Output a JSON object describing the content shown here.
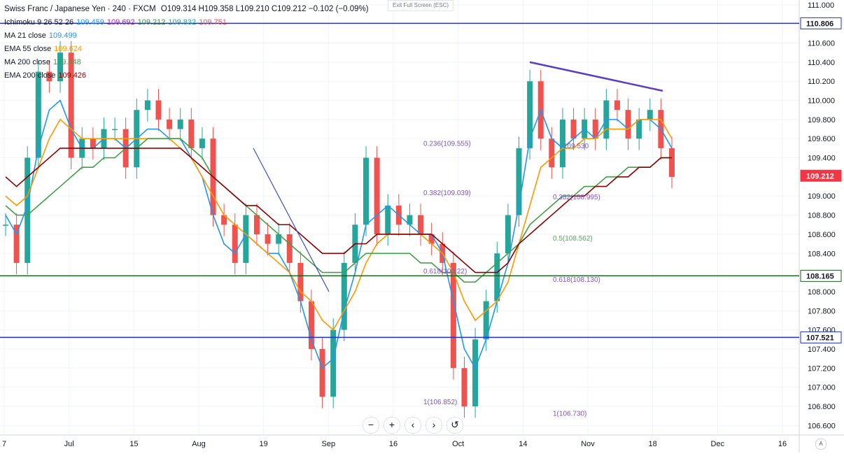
{
  "header": {
    "symbol_line": "Swiss Franc / Japanese Yen · 240 · FXCM",
    "ohlc": "O109.314  H109.358  L109.210  C109.212  −0.102 (−0.09%)",
    "exit_fullscreen": "Exit Full Screen (ESC)"
  },
  "legend": [
    {
      "label": "Ichimoku 9 26 52 26",
      "values": [
        "109.459",
        "109.692",
        "109.212",
        "109.832",
        "109.751"
      ],
      "colors": [
        "#2196f3",
        "#9c27b0",
        "#388e3c",
        "#26a69a",
        "#ef5350"
      ]
    },
    {
      "label": "MA 21 close",
      "values": [
        "109.499"
      ],
      "colors": [
        "#2196f3"
      ]
    },
    {
      "label": "EMA 55 close",
      "values": [
        "109.624"
      ],
      "colors": [
        "#ff9800"
      ]
    },
    {
      "label": "MA 200 close",
      "values": [
        "109.448"
      ],
      "colors": [
        "#43a047"
      ]
    },
    {
      "label": "EMA 200 close",
      "values": [
        "109.426"
      ],
      "colors": [
        "#8b0000"
      ]
    }
  ],
  "toolbar": {
    "zoom_out": "−",
    "zoom_in": "+",
    "prev": "‹",
    "next": "›",
    "reset": "↺"
  },
  "corner_label": "A",
  "colors": {
    "up": "#26a69a",
    "down": "#ef5350",
    "ma21": "#2196f3",
    "ema55": "#ff9800",
    "ma200": "#43a047",
    "ema200": "#8b0000",
    "hline_blue": "#1f2fd8",
    "hline_green": "#1b5e20",
    "trend": "#5c3dbf",
    "fib": "#7e57c2",
    "fib_green": "#4caf50"
  },
  "chart_data": {
    "type": "line",
    "title": "Swiss Franc / Japanese Yen · 240 · FXCM",
    "xlabel": "",
    "ylabel": "",
    "ylim": [
      106.5,
      111.05
    ],
    "y_ticks": [
      "111.000",
      "110.600",
      "110.400",
      "110.200",
      "110.000",
      "109.800",
      "109.600",
      "109.400",
      "109.000",
      "108.800",
      "108.600",
      "108.400",
      "108.000",
      "107.800",
      "107.600",
      "107.400",
      "107.200",
      "107.000",
      "106.800",
      "106.600"
    ],
    "x_ticks": [
      "7",
      "Jul",
      "15",
      "Aug",
      "19",
      "Sep",
      "16",
      "Oct",
      "14",
      "Nov",
      "18",
      "Dec",
      "16"
    ],
    "price_labels": [
      {
        "text": "110.806",
        "value": 110.806,
        "style": "blue"
      },
      {
        "text": "109.212",
        "value": 109.212,
        "style": "red"
      },
      {
        "text": "108.165",
        "value": 108.165,
        "style": "green"
      },
      {
        "text": "107.521",
        "value": 107.521,
        "style": "blue"
      }
    ],
    "horizontal_lines": [
      {
        "value": 110.806,
        "color": "blue"
      },
      {
        "value": 108.165,
        "color": "green"
      },
      {
        "value": 107.521,
        "color": "blue"
      }
    ],
    "fib_labels": [
      {
        "text": "0.236(109.555)",
        "value": 109.555
      },
      {
        "text": "0.382(109.039)",
        "value": 109.039
      },
      {
        "text": "0.618(108.22)",
        "value": 108.22
      },
      {
        "text": "1(106.852)",
        "value": 106.852
      },
      {
        "text": "0.382(108.995)",
        "value": 108.995
      },
      {
        "text": "0.5(108.562)",
        "value": 108.562
      },
      {
        "text": "0.618(108.130)",
        "value": 108.13
      },
      {
        "text": "1(106.730)",
        "value": 106.73
      },
      {
        "text": "109.530",
        "value": 109.53
      }
    ],
    "series": [
      {
        "name": "Price",
        "values": [
          108.7,
          108.3,
          109.4,
          110.3,
          110.2,
          110.5,
          109.4,
          109.6,
          109.5,
          109.7,
          109.7,
          109.3,
          109.9,
          110.0,
          109.8,
          109.7,
          109.8,
          109.5,
          109.6,
          108.8,
          108.7,
          108.3,
          108.8,
          108.6,
          108.5,
          108.6,
          108.3,
          107.9,
          107.4,
          106.9,
          107.6,
          108.3,
          108.7,
          109.4,
          108.6,
          108.9,
          108.7,
          108.8,
          108.6,
          108.5,
          108.3,
          107.2,
          106.8,
          107.5,
          107.9,
          108.4,
          108.8,
          109.5,
          110.2,
          109.6,
          109.3,
          109.8,
          109.6,
          109.8,
          109.6,
          110.0,
          109.9,
          109.6,
          109.8,
          109.9,
          109.5,
          109.2
        ]
      },
      {
        "name": "MA 21 close",
        "values": [
          108.8,
          108.6,
          108.9,
          109.5,
          109.9,
          110.0,
          109.7,
          109.5,
          109.5,
          109.6,
          109.6,
          109.5,
          109.6,
          109.7,
          109.7,
          109.6,
          109.6,
          109.4,
          109.2,
          108.8,
          108.5,
          108.4,
          108.6,
          108.5,
          108.4,
          108.4,
          108.2,
          107.9,
          107.5,
          107.2,
          107.3,
          107.8,
          108.2,
          108.7,
          108.8,
          108.9,
          108.8,
          108.7,
          108.6,
          108.6,
          108.4,
          107.9,
          107.4,
          107.2,
          107.5,
          107.9,
          108.3,
          108.9,
          109.6,
          109.9,
          109.6,
          109.5,
          109.6,
          109.7,
          109.6,
          109.8,
          109.8,
          109.7,
          109.8,
          109.8,
          109.7,
          109.5
        ]
      },
      {
        "name": "EMA 55 close",
        "values": [
          109.0,
          108.9,
          109.0,
          109.3,
          109.6,
          109.8,
          109.7,
          109.6,
          109.6,
          109.6,
          109.6,
          109.6,
          109.6,
          109.6,
          109.6,
          109.6,
          109.5,
          109.4,
          109.2,
          109.0,
          108.8,
          108.7,
          108.6,
          108.5,
          108.4,
          108.3,
          108.2,
          108.0,
          107.9,
          107.7,
          107.6,
          107.8,
          108.0,
          108.3,
          108.5,
          108.6,
          108.6,
          108.6,
          108.6,
          108.5,
          108.4,
          108.2,
          107.9,
          107.7,
          107.8,
          107.9,
          108.1,
          108.5,
          108.9,
          109.3,
          109.4,
          109.5,
          109.5,
          109.6,
          109.6,
          109.7,
          109.7,
          109.7,
          109.8,
          109.8,
          109.8,
          109.6
        ]
      },
      {
        "name": "MA 200 close",
        "values": [
          108.9,
          108.8,
          108.8,
          108.9,
          109.0,
          109.1,
          109.2,
          109.3,
          109.3,
          109.4,
          109.4,
          109.5,
          109.5,
          109.6,
          109.6,
          109.6,
          109.6,
          109.5,
          109.4,
          109.2,
          109.1,
          109.0,
          108.9,
          108.8,
          108.7,
          108.6,
          108.5,
          108.4,
          108.3,
          108.2,
          108.2,
          108.2,
          108.3,
          108.4,
          108.4,
          108.4,
          108.4,
          108.4,
          108.3,
          108.3,
          108.2,
          108.2,
          108.1,
          108.1,
          108.2,
          108.3,
          108.4,
          108.5,
          108.7,
          108.8,
          108.9,
          109.0,
          109.0,
          109.1,
          109.1,
          109.2,
          109.2,
          109.3,
          109.3,
          109.3,
          109.4,
          109.4
        ]
      },
      {
        "name": "EMA 200 close",
        "values": [
          109.2,
          109.1,
          109.2,
          109.3,
          109.4,
          109.5,
          109.5,
          109.5,
          109.5,
          109.5,
          109.5,
          109.5,
          109.5,
          109.5,
          109.5,
          109.5,
          109.5,
          109.4,
          109.3,
          109.2,
          109.1,
          109.0,
          108.9,
          108.9,
          108.8,
          108.7,
          108.7,
          108.6,
          108.5,
          108.4,
          108.4,
          108.4,
          108.5,
          108.5,
          108.6,
          108.6,
          108.6,
          108.6,
          108.6,
          108.6,
          108.5,
          108.4,
          108.3,
          108.2,
          108.2,
          108.2,
          108.3,
          108.5,
          108.6,
          108.7,
          108.8,
          108.9,
          109.0,
          109.0,
          109.1,
          109.1,
          109.2,
          109.2,
          109.3,
          109.3,
          109.4,
          109.4
        ]
      }
    ],
    "grid": true
  }
}
